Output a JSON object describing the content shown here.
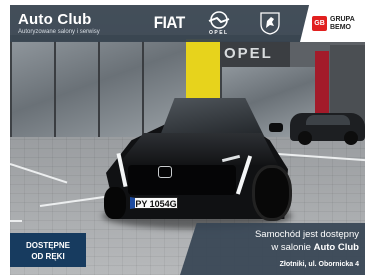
{
  "header": {
    "dealer_name": "Auto Club",
    "dealer_tagline": "Autoryzowane salony i serwisy",
    "brand_fiat": "FIAT",
    "brand_opel": "OPEL",
    "group_badge": "GB",
    "group_label_1": "GRUPA",
    "group_label_2": "BEMO"
  },
  "scene": {
    "building_sign": "OPEL",
    "license_plate": "PY 1054G"
  },
  "availability_badge": {
    "line1": "DOSTĘPNE",
    "line2": "OD RĘKI"
  },
  "info_panel": {
    "line1": "Samochód jest dostępny",
    "line2_prefix": "w salonie ",
    "line2_dealer": "Auto Club",
    "address": "Złotniki, ul. Obornicka 4"
  },
  "colors": {
    "bar": "#384450",
    "badge_blue": "#173b5f",
    "bemo_red": "#e1201f",
    "pillar_yellow": "#e7d31c"
  }
}
